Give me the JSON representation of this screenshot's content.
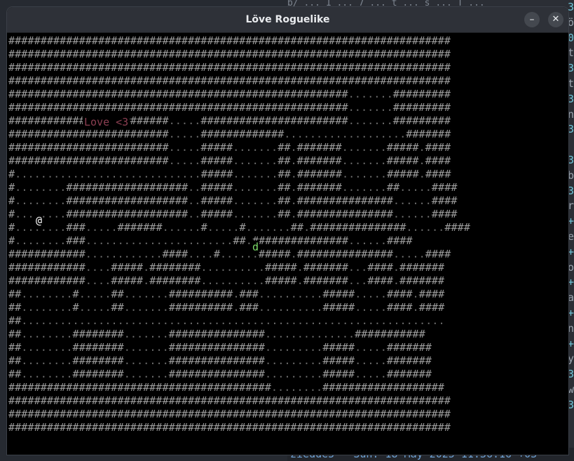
{
  "window": {
    "title": "Löve Roguelike",
    "minimize_label": "–",
    "close_label": "✕"
  },
  "game": {
    "player_glyph": "@",
    "monster_glyph": "d",
    "overlay_text": "Love <3",
    "map_rows": [
      "#####################################################################",
      "#####################################################################",
      "#####################################################################",
      "#####################################################################",
      "#####################################################.......#########",
      "#####################################################.......#########",
      "#########################.....#######################.......#########",
      "#########################.....#############...................#######",
      "#########################.....#####.......##.#######.......#####.####",
      "#########################.....#####.......##.#######.......#####.####",
      "#.............................#####.......##.#######.......#####.####",
      "#........###################..#####.......##.#######.......##.....####",
      "#........###################..#####.......##.###############......####",
      "#........###################..#####.......##.###############......####",
      "#........###.....#######......#.....#.......##.###############......####",
      "#........###.......................##.###############......####",
      "############............####....#......#####.###############.....####",
      "############....#####.########..........#####.#######...####.#######",
      "############....#####.########..........#####.#######...####.#######",
      "##........#.....##.......##########.###..........#####.....####.####",
      "##........#.....##.......##########.###..........#####.....####.####",
      "##..................................................................",
      "##........########.......###############..............###########",
      "##........########.......###############.........#####.....#######",
      "##........########.......###############.........#####.....#######",
      "##........########.......###############.........#####.....#######",
      "#########################################........###################",
      "#####################################################################",
      "#####################################################################",
      "#####################################################################"
    ]
  },
  "terminal": {
    "right_glyphs": [
      "3",
      "ö",
      "0",
      "t",
      "3",
      "t",
      "3",
      "n",
      "3",
      "",
      "3",
      "b",
      "3",
      "r",
      "+",
      "e",
      "+",
      "o",
      "+",
      "a",
      "+",
      "n",
      "+",
      "y",
      "3",
      "w",
      "3"
    ],
    "bottom_line": "ziedde5 - Sun. 18 May 2025 11:36:16 +03",
    "top_line": "b/ ... 1 ... 7 ... t ... s ... T ..."
  },
  "colors": {
    "wall": "#9b9b9b",
    "floor": "#6a6a6a",
    "player": "#ffffff",
    "monster": "#7ddc6a",
    "overlay": "#8c3f52",
    "titlebar": "#2e3138"
  }
}
